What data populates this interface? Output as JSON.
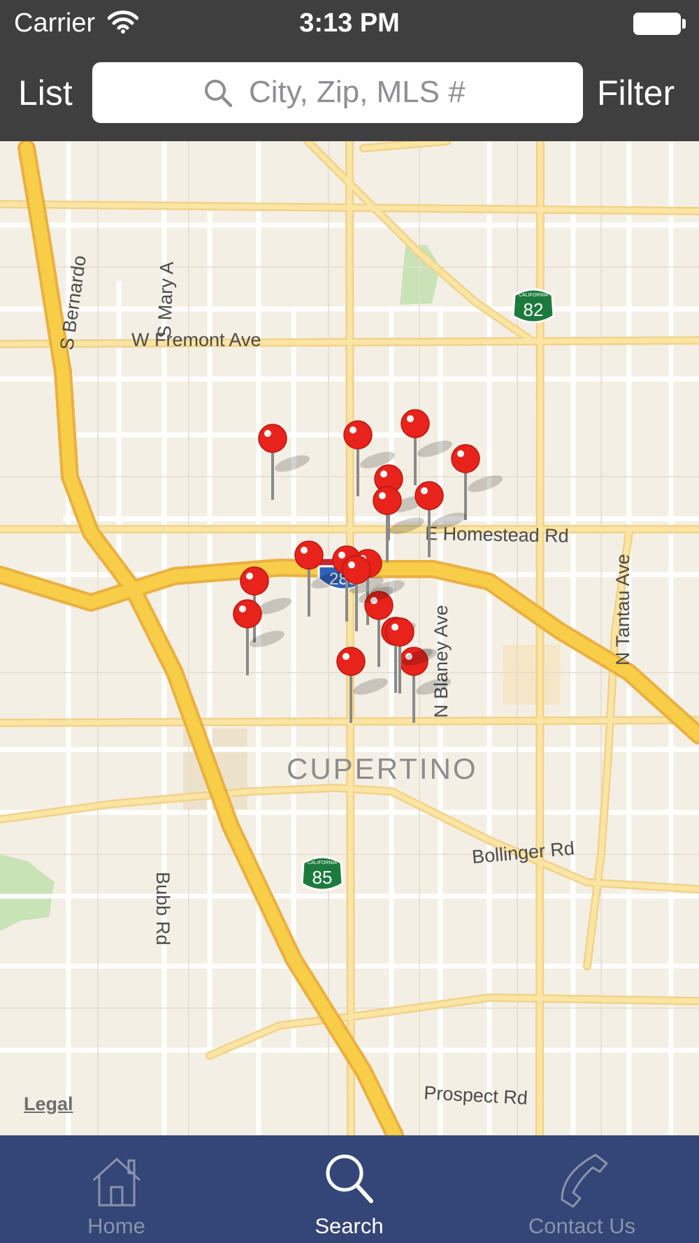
{
  "status_bar": {
    "carrier": "Carrier",
    "time": "3:13 PM"
  },
  "nav": {
    "left_label": "List",
    "right_label": "Filter",
    "search": {
      "placeholder": "City, Zip, MLS #",
      "value": "",
      "icon": "search-icon"
    }
  },
  "map": {
    "city_label": "CUPERTINO",
    "streets": {
      "fremont": "W Fremont Ave",
      "homestead": "E Homestead Rd",
      "blaney": "N Blaney Ave",
      "tantau": "N Tantau Ave",
      "bollinger": "Bollinger Rd",
      "bubb": "Bubb Rd",
      "prospect": "Prospect Rd",
      "bernardo": "S Bernardo",
      "mary": "S Mary A"
    },
    "shields": {
      "hwy82": "82",
      "hwy85": "85",
      "i280": "280",
      "california": "CALIFORNIA"
    },
    "legal_label": "Legal",
    "pin_count": 18,
    "colors": {
      "land": "#f4efe4",
      "highway": "#f7cd47",
      "road": "#fbe4a6",
      "pin": "#e8231b"
    }
  },
  "tabs": [
    {
      "label": "Home",
      "icon": "home-icon",
      "active": false
    },
    {
      "label": "Search",
      "icon": "search-icon",
      "active": true
    },
    {
      "label": "Contact Us",
      "icon": "phone-icon",
      "active": false
    }
  ]
}
